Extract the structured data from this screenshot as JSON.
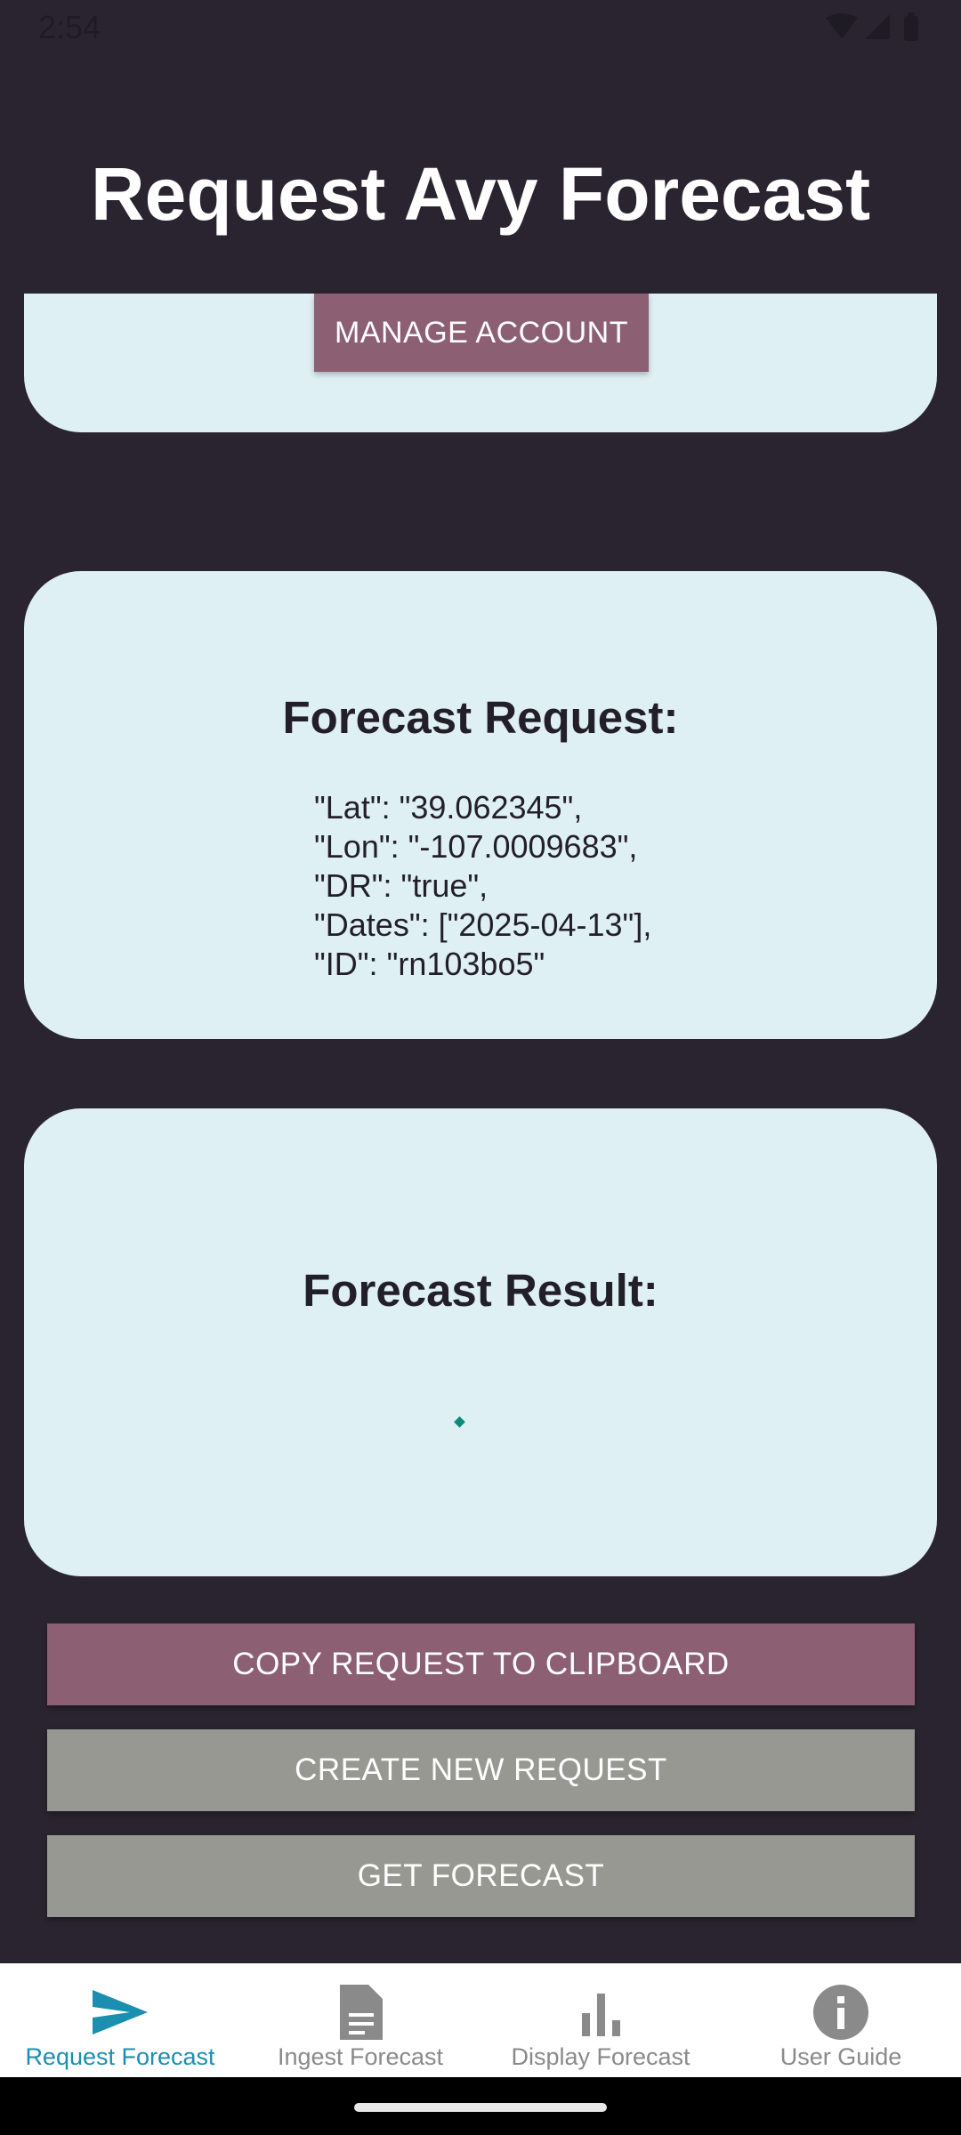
{
  "status": {
    "time": "2:54",
    "icons": [
      "wifi-icon",
      "cellular-signal-icon",
      "battery-icon"
    ]
  },
  "title": "Request Avy Forecast",
  "account": {
    "manage_label": "MANAGE ACCOUNT"
  },
  "request_card": {
    "heading": "Forecast Request:",
    "lines": [
      "\"Lat\": \"39.062345\",",
      "\"Lon\": \"-107.0009683\",",
      "\"DR\": \"true\",",
      "\"Dates\": [\"2025-04-13\"],",
      "\"ID\": \"rn103bo5\""
    ]
  },
  "result_card": {
    "heading": "Forecast Result:"
  },
  "actions": {
    "copy_label": "COPY REQUEST TO CLIPBOARD",
    "new_label": "CREATE NEW REQUEST",
    "get_label": "GET FORECAST"
  },
  "nav": {
    "items": [
      {
        "label": "Request Forecast",
        "icon": "send-icon",
        "active": true
      },
      {
        "label": "Ingest Forecast",
        "icon": "document-icon",
        "active": false
      },
      {
        "label": "Display Forecast",
        "icon": "bar-chart-icon",
        "active": false
      },
      {
        "label": "User Guide",
        "icon": "info-icon",
        "active": false
      }
    ]
  },
  "colors": {
    "background": "#2a2430",
    "card": "#dff0f5",
    "primary_button": "#8c5f73",
    "secondary_button": "#979892",
    "nav_active": "#1a8fb0",
    "nav_inactive": "#8a8a8a"
  }
}
